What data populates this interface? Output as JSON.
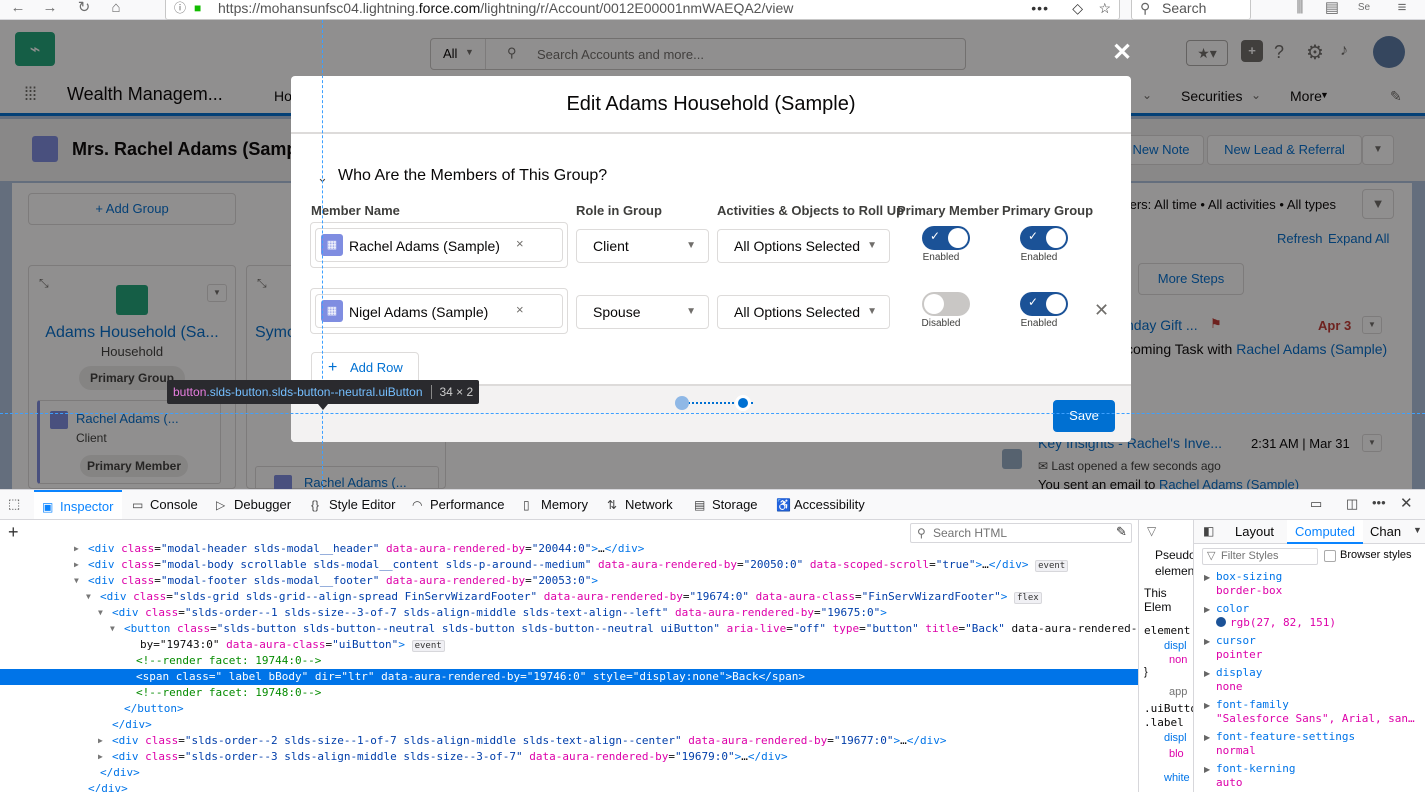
{
  "browser": {
    "url_prefix": "https://mohansunfsc04.lightning.",
    "url_host": "force.com",
    "url_suffix": "/lightning/r/Account/0012E00001nmWAEQA2/view",
    "search_placeholder": "Search",
    "more_glyph": "•••"
  },
  "sf": {
    "search_scope": "All",
    "search_placeholder": "Search Accounts and more...",
    "app_name": "Wealth Managem...",
    "nav_partial": "Ho",
    "nav_items": [
      "Securities",
      "More"
    ],
    "record_title": "Mrs. Rachel Adams (Samp",
    "buttons": {
      "new_note": "New Note",
      "new_lead": "New Lead & Referral"
    },
    "add_group": "+ Add Group",
    "group_name": "Adams Household (Sa...",
    "group_type": "Household",
    "primary_group_pill": "Primary Group",
    "member_name": "Rachel Adams (...",
    "member_role": "Client",
    "primary_member_pill": "Primary Member",
    "partial_group": "Symo",
    "second_member": "Rachel Adams (...",
    "filters_text": "ters: All time • All activities • All types",
    "refresh": "Refresh",
    "expand_all": "Expand All",
    "more_steps": "More Steps",
    "task_title": "nday Gift ...",
    "task_date": "Apr 3",
    "task_line_prefix": "coming Task with ",
    "task_line_link": "Rachel Adams (Sample)",
    "email_title": "Key Insights - Rachel's Inve...",
    "email_time": "2:31 AM | Mar 31",
    "email_opened": "Last opened a few seconds ago",
    "email_sent_prefix": "You sent an email to ",
    "email_sent_link": "Rachel Adams (Sample)"
  },
  "modal": {
    "title": "Edit Adams Household (Sample)",
    "section": "Who Are the Members of This Group?",
    "columns": [
      "Member Name",
      "Role in Group",
      "Activities & Objects to Roll Up",
      "Primary Member",
      "Primary Group"
    ],
    "rows": [
      {
        "member": "Rachel Adams (Sample)",
        "role": "Client",
        "rollup": "All Options Selected",
        "primary_member": "Enabled",
        "primary_group": "Enabled"
      },
      {
        "member": "Nigel Adams (Sample)",
        "role": "Spouse",
        "rollup": "All Options Selected",
        "primary_member": "Disabled",
        "primary_group": "Enabled"
      }
    ],
    "add_row": "Add Row",
    "save": "Save"
  },
  "highlighter": {
    "tag": "button",
    "classes": ".slds-button.slds-button--neutral.uiButton",
    "size": "34 × 2"
  },
  "devtools": {
    "tabs": [
      "Inspector",
      "Console",
      "Debugger",
      "Style Editor",
      "Performance",
      "Memory",
      "Network",
      "Storage",
      "Accessibility"
    ],
    "search_html": "Search HTML",
    "sidebar_tabs": [
      "Layout",
      "Computed",
      "Chan"
    ],
    "filter_styles": "Filter Styles",
    "browser_styles": "Browser styles",
    "side_labels": [
      "Pseudo",
      "elemen",
      "This Elem",
      "element",
      "displ",
      "non",
      "}",
      "app",
      ".uiButto",
      ".label",
      "displ",
      "blo",
      "white"
    ],
    "tree": [
      {
        "indent": 0,
        "arrow": "▶",
        "html": "<div class=\"modal-header slds-modal__header\" data-aura-rendered-by=\"20044:0\">…</div>"
      },
      {
        "indent": 0,
        "arrow": "▶",
        "html": "<div class=\"modal-body scrollable slds-modal__content slds-p-around--medium\" data-aura-rendered-by=\"20050:0\" data-scoped-scroll=\"true\">…</div>",
        "badge": "event"
      },
      {
        "indent": 0,
        "arrow": "▼",
        "html": "<div class=\"modal-footer slds-modal__footer\" data-aura-rendered-by=\"20053:0\">"
      },
      {
        "indent": 1,
        "arrow": "▼",
        "html": "<div class=\"slds-grid slds-grid--align-spread FinServWizardFooter\" data-aura-rendered-by=\"19674:0\" data-aura-class=\"FinServWizardFooter\">",
        "badge": "flex"
      },
      {
        "indent": 2,
        "arrow": "▼",
        "html": "<div class=\"slds-order--1 slds-size--3-of-7 slds-align-middle slds-text-align--left\" data-aura-rendered-by=\"19675:0\">"
      },
      {
        "indent": 3,
        "arrow": "▼",
        "html": "<button class=\"slds-button slds-button--neutral slds-button slds-button--neutral uiButton\" aria-live=\"off\" type=\"button\" title=\"Back\" data-aura-rendered-"
      },
      {
        "indent": 3,
        "arrow": "",
        "html": "by=\"19743:0\" data-aura-class=\"uiButton\">",
        "badge": "event",
        "cont": true
      },
      {
        "indent": 4,
        "arrow": "",
        "html": "<!--render facet: 19744:0-->",
        "comment": true
      },
      {
        "indent": 4,
        "arrow": "",
        "html": "<span class=\" label bBody\" dir=\"ltr\" data-aura-rendered-by=\"19746:0\" style=\"display:none\">Back</span>",
        "selected": true
      },
      {
        "indent": 4,
        "arrow": "",
        "html": "<!--render facet: 19748:0-->",
        "comment": true
      },
      {
        "indent": 3,
        "arrow": "",
        "html": "</button>"
      },
      {
        "indent": 2,
        "arrow": "",
        "html": "</div>"
      },
      {
        "indent": 2,
        "arrow": "▶",
        "html": "<div class=\"slds-order--2 slds-size--1-of-7 slds-align-middle slds-text-align--center\" data-aura-rendered-by=\"19677:0\">…</div>"
      },
      {
        "indent": 2,
        "arrow": "▶",
        "html": "<div class=\"slds-order--3 slds-align-middle slds-size--3-of-7\" data-aura-rendered-by=\"19679:0\">…</div>"
      },
      {
        "indent": 1,
        "arrow": "",
        "html": "</div>"
      },
      {
        "indent": 0,
        "arrow": "",
        "html": "</div>"
      }
    ],
    "computed": [
      {
        "prop": "box-sizing",
        "val": "border-box"
      },
      {
        "prop": "color",
        "val": "rgb(27, 82, 151)",
        "swatch": "#1b5297"
      },
      {
        "prop": "cursor",
        "val": "pointer"
      },
      {
        "prop": "display",
        "val": "none"
      },
      {
        "prop": "font-family",
        "val": "\"Salesforce Sans\", Arial, san…"
      },
      {
        "prop": "font-feature-settings",
        "val": "normal"
      },
      {
        "prop": "font-kerning",
        "val": "auto"
      }
    ]
  },
  "colors": {
    "brand": "#0070d2",
    "save": "#0070d2",
    "toggle_on": "#1b5297",
    "toggle_off": "#c9c7c5",
    "devtools_accent": "#0074e8"
  }
}
